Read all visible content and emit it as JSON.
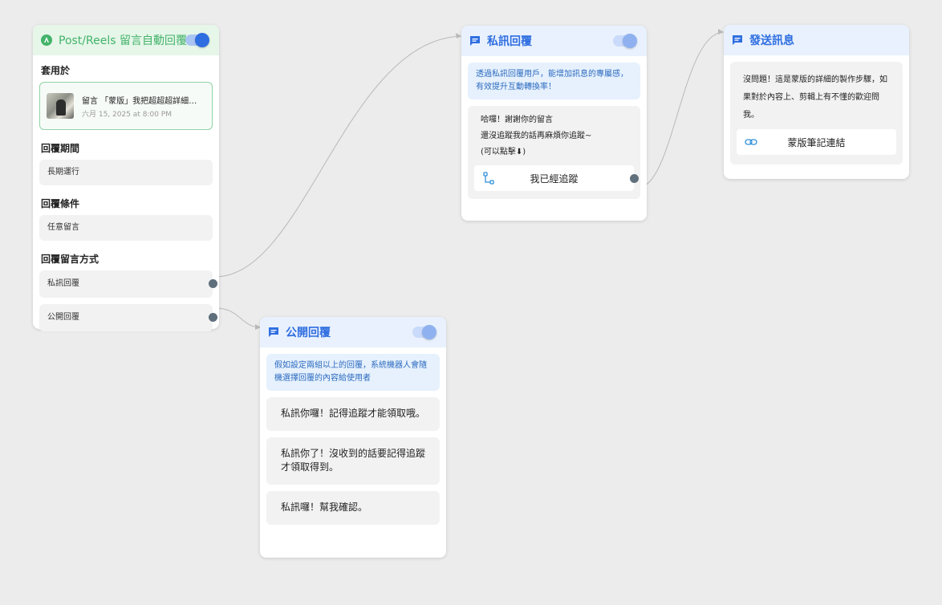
{
  "trigger_card": {
    "title": "Post/Reels 留言自動回覆",
    "apply_label": "套用於",
    "post": {
      "title": "留言 「蒙版」我把超超超詳細步...",
      "date": "六月 15, 2025 at 8:00 PM"
    },
    "period_label": "回覆期間",
    "period_value": "長期運行",
    "condition_label": "回覆條件",
    "condition_value": "任意留言",
    "method_label": "回覆留言方式",
    "methods": [
      "私訊回覆",
      "公開回覆"
    ]
  },
  "private_card": {
    "title": "私訊回覆",
    "info": "透過私訊回覆用戶，能增加訊息的專屬感，有效提升互動轉換率！",
    "message_lines": [
      "哈囉！謝謝你的留言",
      "還沒追蹤我的話再麻煩你追蹤~",
      "(可以點擊⬇)"
    ],
    "button_label": "我已經追蹤"
  },
  "send_card": {
    "title": "發送訊息",
    "message": "沒問題！這是蒙版的詳細的製作步驟，如果對於內容上、剪輯上有不懂的歡迎問我。",
    "link_label": "蒙版筆記連結"
  },
  "public_card": {
    "title": "公開回覆",
    "info": "假如設定兩組以上的回覆，系統機器人會隨機選擇回覆的內容給使用者",
    "replies": [
      "私訊你囉！記得追蹤才能領取哦。",
      "私訊你了！沒收到的話要記得追蹤才領取得到。",
      "私訊囉！幫我確認。"
    ]
  },
  "icons": {
    "trigger": "instagram-badge-icon",
    "card_header": "chat-bubble-icon",
    "flow_button": "flow-branch-icon",
    "link_button": "link-icon"
  },
  "colors": {
    "accent_blue": "#2f6ee0",
    "accent_green": "#43b36a",
    "canvas": "#ececec",
    "connector": "#b8b8b8"
  }
}
